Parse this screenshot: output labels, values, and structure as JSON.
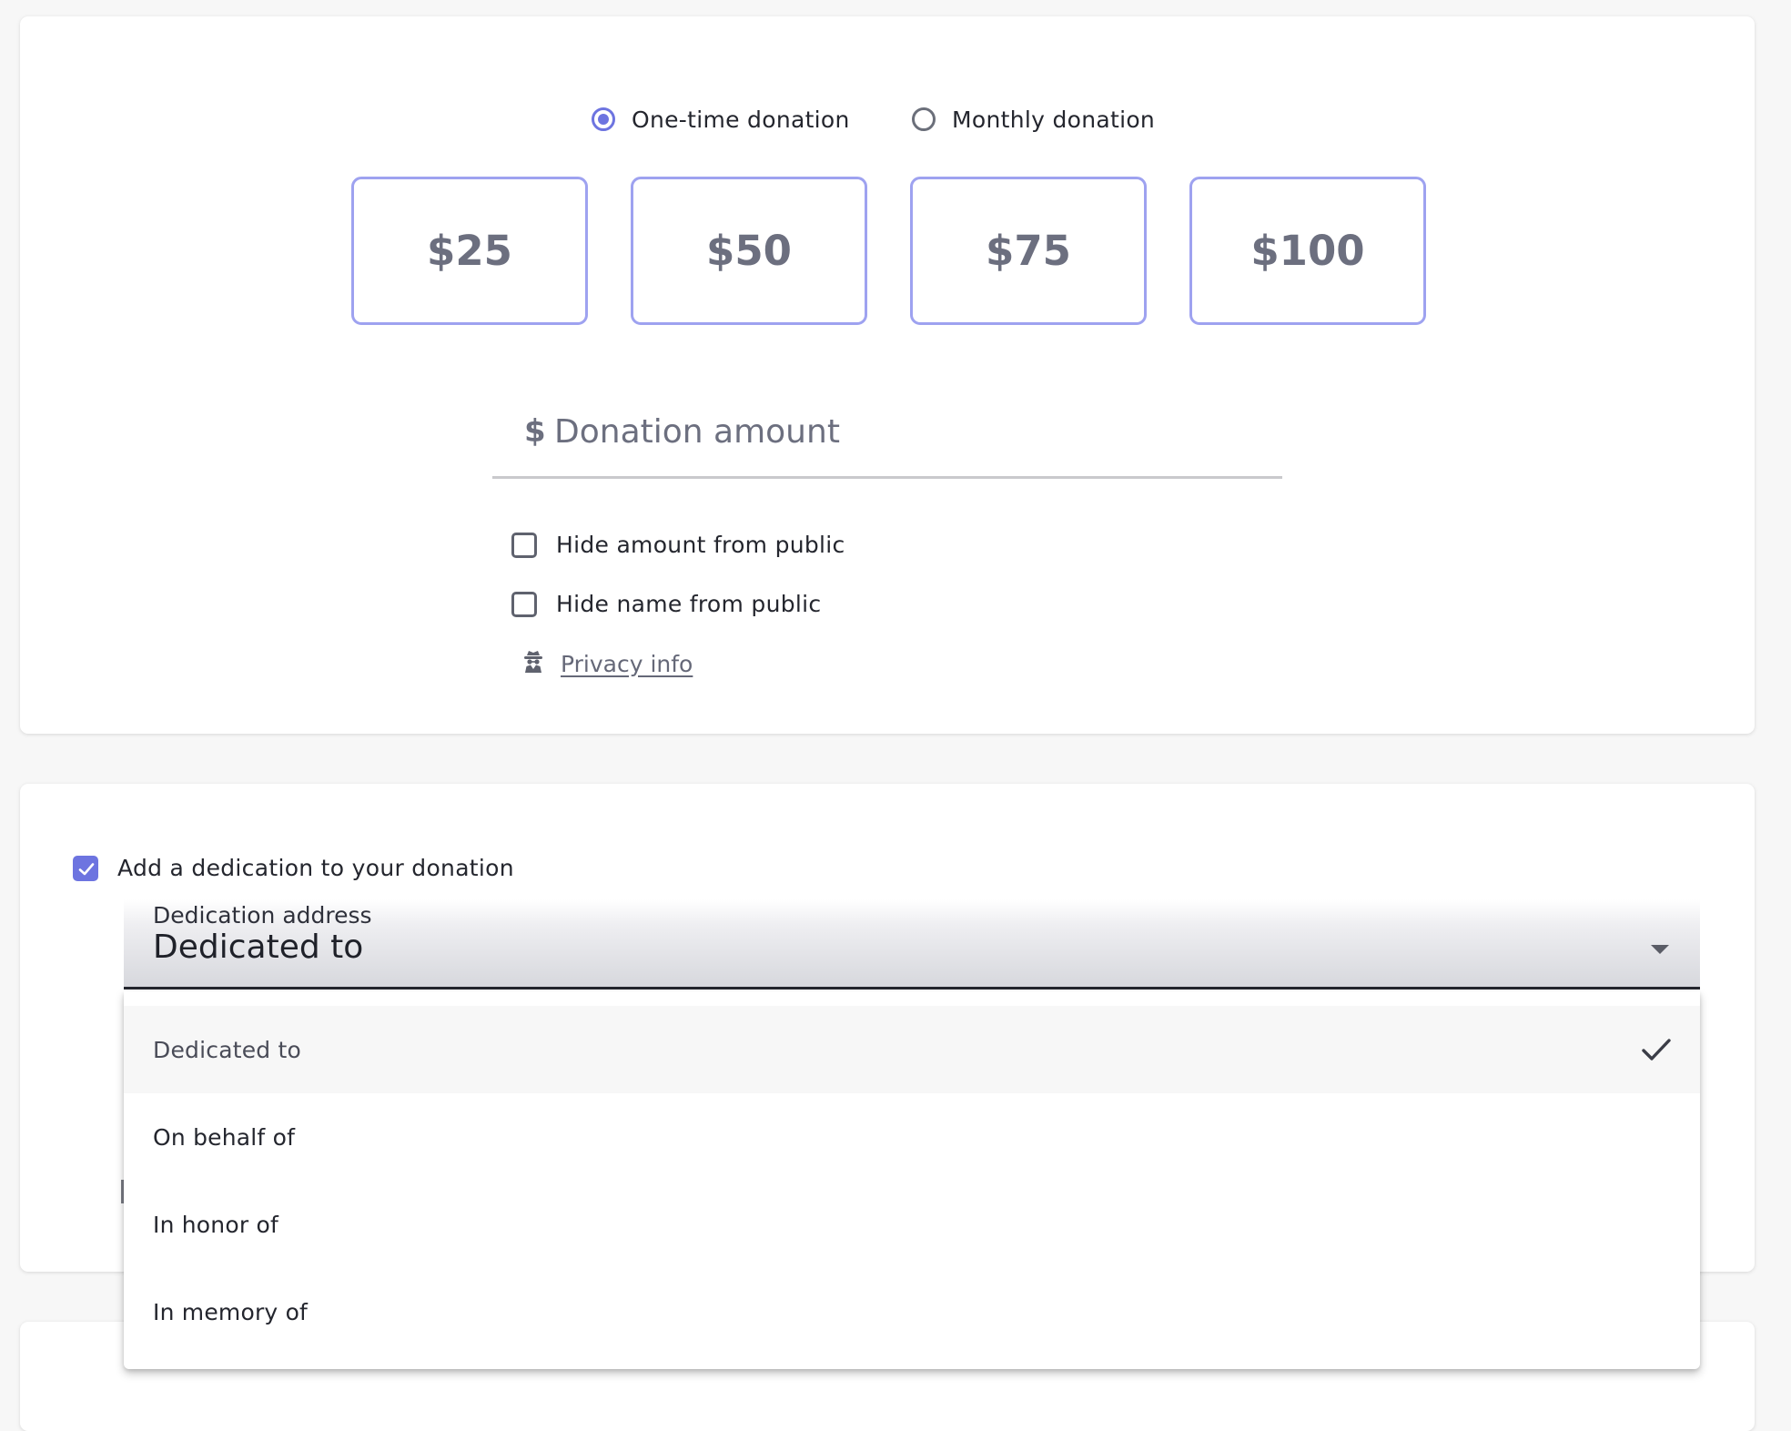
{
  "frequency": {
    "options": [
      {
        "label": "One-time donation",
        "selected": true
      },
      {
        "label": "Monthly donation",
        "selected": false
      }
    ]
  },
  "preset_amounts": [
    "$25",
    "$50",
    "$75",
    "$100"
  ],
  "donation_input": {
    "currency_symbol": "$",
    "placeholder": "Donation amount",
    "value": ""
  },
  "privacy": {
    "hide_amount": {
      "label": "Hide amount from public",
      "checked": false
    },
    "hide_name": {
      "label": "Hide name from public",
      "checked": false
    },
    "privacy_link": {
      "label": "Privacy info",
      "icon": "spy-icon"
    }
  },
  "dedication": {
    "checkbox": {
      "label": "Add a dedication to your donation",
      "checked": true
    },
    "select": {
      "label": "Dedication address",
      "value": "Dedicated to",
      "options": [
        "Dedicated to",
        "On behalf of",
        "In honor of",
        "In memory of"
      ],
      "selected_index": 0
    }
  },
  "colors": {
    "accent": "#6d74e0",
    "amount_border": "#9ea2f0",
    "muted_text": "#6c6f7f",
    "page_background": "#f7f7f7"
  }
}
